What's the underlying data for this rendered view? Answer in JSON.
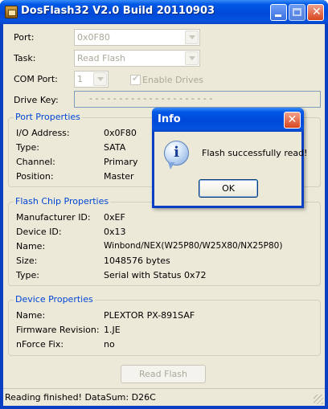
{
  "window": {
    "title": "DosFlash32 V2.0 Build 20110903",
    "controls": {
      "minimize": "minimize",
      "maximize": "maximize",
      "close": "✕"
    }
  },
  "form": {
    "port": {
      "label": "Port:",
      "value": "0x0F80"
    },
    "task": {
      "label": "Task:",
      "value": "Read Flash"
    },
    "com_port": {
      "label": "COM Port:",
      "value": "1"
    },
    "enable_drives": {
      "label": "Enable Drives",
      "checked": true
    },
    "drive_key": {
      "label": "Drive Key:",
      "value": "- - - - - - - - - - - - - - - - - - - - -"
    }
  },
  "port_properties": {
    "title": "Port Properties",
    "rows": [
      {
        "label": "I/O Address:",
        "value": "0x0F80"
      },
      {
        "label": "Type:",
        "value": "SATA"
      },
      {
        "label": "Channel:",
        "value": "Primary"
      },
      {
        "label": "Position:",
        "value": "Master"
      }
    ]
  },
  "flash_chip_properties": {
    "title": "Flash Chip Properties",
    "rows": [
      {
        "label": "Manufacturer ID:",
        "value": "0xEF"
      },
      {
        "label": "Device ID:",
        "value": "0x13"
      },
      {
        "label": "Name:",
        "value": "Winbond/NEX(W25P80/W25X80/NX25P80)"
      },
      {
        "label": "Size:",
        "value": "1048576 bytes"
      },
      {
        "label": "Type:",
        "value": "Serial with Status 0x72"
      }
    ]
  },
  "device_properties": {
    "title": "Device Properties",
    "rows": [
      {
        "label": "Name:",
        "value": "PLEXTOR PX-891SAF"
      },
      {
        "label": "Firmware Revision:",
        "value": "1.JE"
      },
      {
        "label": "nForce Fix:",
        "value": "no"
      }
    ]
  },
  "actions": {
    "read_flash": "Read Flash"
  },
  "status": {
    "text": "Reading finished! DataSum: D26C"
  },
  "dialog": {
    "title": "Info",
    "close": "✕",
    "message": "Flash successfully read!",
    "ok": "OK",
    "icon": "information-icon"
  },
  "colors": {
    "title_blue": "#0058e6",
    "group_title": "#0046d5",
    "face": "#ece9d8"
  }
}
